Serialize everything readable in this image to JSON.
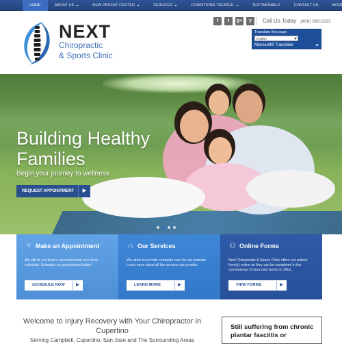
{
  "nav": {
    "items": [
      {
        "label": "Home",
        "active": true,
        "dropdown": false
      },
      {
        "label": "About Us",
        "active": false,
        "dropdown": true
      },
      {
        "label": "New Patient Center",
        "active": false,
        "dropdown": true
      },
      {
        "label": "Services",
        "active": false,
        "dropdown": true
      },
      {
        "label": "Conditions Treated",
        "active": false,
        "dropdown": true
      },
      {
        "label": "Testimonials",
        "active": false,
        "dropdown": false
      },
      {
        "label": "Contact Us",
        "active": false,
        "dropdown": false
      },
      {
        "label": "More",
        "active": false,
        "dropdown": true
      }
    ]
  },
  "header": {
    "brand_name": "NEXT",
    "brand_line1": "Chiropractic",
    "brand_line2": "& Sports Clinic",
    "social": [
      {
        "icon": "facebook-icon",
        "glyph": "f"
      },
      {
        "icon": "twitter-icon",
        "glyph": "t"
      },
      {
        "icon": "google-plus-icon",
        "glyph": "g+"
      },
      {
        "icon": "yelp-icon",
        "glyph": "y"
      }
    ],
    "call_label": "Call Us Today",
    "phone": "(408) 260-0222"
  },
  "translator": {
    "title": "Translate this page",
    "select_value": "English",
    "brand": "Microsoft® Translator",
    "icons": "◂▸"
  },
  "hero": {
    "title_line1": "Building Healthy",
    "title_line2": "Families",
    "subtitle": "Begin your journey to wellness",
    "button_label": "Request Appointment",
    "slides": 4,
    "active_slide": 1
  },
  "panels": [
    {
      "icon": "cutlery-icon",
      "glyph": "⑂",
      "title": "Make an Appointment",
      "body": "We will do our best to accommodate your busy schedule. Schedule an appointment today!",
      "button": "Schedule Now"
    },
    {
      "icon": "headset-icon",
      "glyph": "∩",
      "title": "Our Services",
      "body": "We strive to provide complete care for our patients. Learn more about all the services we provide.",
      "button": "Learn More"
    },
    {
      "icon": "online-forms-icon",
      "glyph": "⚇",
      "title": "Online Forms",
      "body": "Next Chiropractic & Sports Clinic offers our patient form(s) online so they can be completed in the convenience of your own home or office.",
      "button": "View Forms"
    }
  ],
  "content": {
    "welcome": "Welcome to Injury Recovery with Your Chiropractor in Cupertino",
    "serving": "Serving Campbell, Cupertino, San Jose and The Surrounding Areas",
    "callout": "Still suffering from chronic plantar fasciitis or"
  },
  "colors": {
    "nav": "#2f5596",
    "accent": "#3f6fb7",
    "panel1": "#5a9de3",
    "panel2": "#3a80d0",
    "panel3": "#2b55a1"
  }
}
